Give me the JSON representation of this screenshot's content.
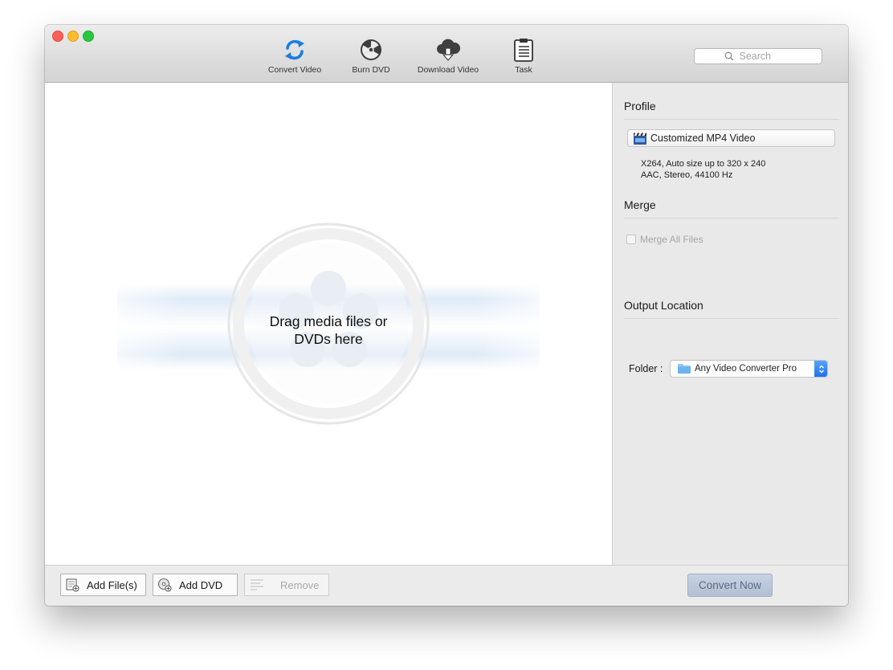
{
  "toolbar": {
    "tools": [
      {
        "label": "Convert Video",
        "icon": "convert-icon"
      },
      {
        "label": "Burn DVD",
        "icon": "burn-dvd-icon"
      },
      {
        "label": "Download Video",
        "icon": "cloud-download-icon"
      },
      {
        "label": "Task",
        "icon": "clipboard-icon"
      }
    ],
    "search": {
      "placeholder": "Search",
      "icon": "search-icon"
    }
  },
  "main": {
    "drop_line1": "Drag media files or",
    "drop_line2": "DVDs here"
  },
  "sidebar": {
    "profile_title": "Profile",
    "profile_value": "Customized MP4 Video",
    "profile_desc_line1": "X264, Auto size up to 320 x 240",
    "profile_desc_line2": "AAC, Stereo, 44100 Hz",
    "merge_title": "Merge",
    "merge_label": "Merge All Files",
    "output_title": "Output Location",
    "folder_label": "Folder :",
    "folder_value": "Any Video Converter Pro"
  },
  "bottom": {
    "add_files": "Add File(s)",
    "add_dvd": "Add DVD",
    "remove": "Remove",
    "convert_now": "Convert Now"
  },
  "colors": {
    "accent_blue": "#1e6fe8",
    "convert_icon": "#1a7de0",
    "close": "#fc5f57",
    "minimize": "#fdbc2e",
    "maximize": "#29c840"
  }
}
